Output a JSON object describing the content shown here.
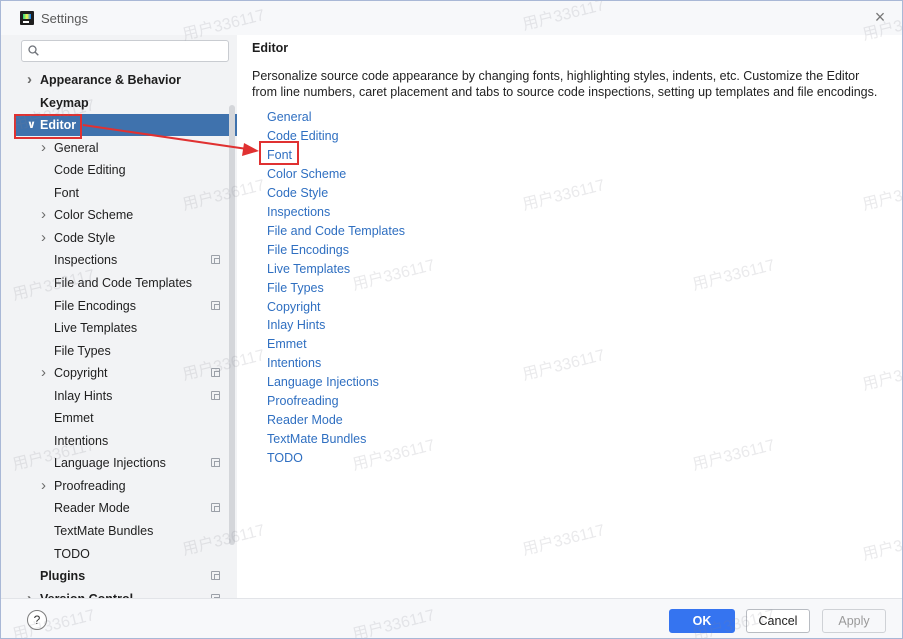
{
  "window": {
    "title": "Settings",
    "close_icon": "×"
  },
  "search": {
    "placeholder": ""
  },
  "sidebar": {
    "items": [
      {
        "label": "Appearance & Behavior",
        "bold": true,
        "chevron": "right",
        "indent": 0,
        "config_icon": false
      },
      {
        "label": "Keymap",
        "bold": true,
        "chevron": "none",
        "indent": 0,
        "config_icon": false
      },
      {
        "label": "Editor",
        "bold": true,
        "chevron": "down",
        "indent": 0,
        "config_icon": false,
        "selected": true
      },
      {
        "label": "General",
        "chevron": "right",
        "indent": 1,
        "config_icon": false
      },
      {
        "label": "Code Editing",
        "chevron": "none",
        "indent": 1,
        "config_icon": false
      },
      {
        "label": "Font",
        "chevron": "none",
        "indent": 1,
        "config_icon": false
      },
      {
        "label": "Color Scheme",
        "chevron": "right",
        "indent": 1,
        "config_icon": false
      },
      {
        "label": "Code Style",
        "chevron": "right",
        "indent": 1,
        "config_icon": false
      },
      {
        "label": "Inspections",
        "chevron": "none",
        "indent": 1,
        "config_icon": true
      },
      {
        "label": "File and Code Templates",
        "chevron": "none",
        "indent": 1,
        "config_icon": false
      },
      {
        "label": "File Encodings",
        "chevron": "none",
        "indent": 1,
        "config_icon": true
      },
      {
        "label": "Live Templates",
        "chevron": "none",
        "indent": 1,
        "config_icon": false
      },
      {
        "label": "File Types",
        "chevron": "none",
        "indent": 1,
        "config_icon": false
      },
      {
        "label": "Copyright",
        "chevron": "right",
        "indent": 1,
        "config_icon": true
      },
      {
        "label": "Inlay Hints",
        "chevron": "none",
        "indent": 1,
        "config_icon": true
      },
      {
        "label": "Emmet",
        "chevron": "none",
        "indent": 1,
        "config_icon": false
      },
      {
        "label": "Intentions",
        "chevron": "none",
        "indent": 1,
        "config_icon": false
      },
      {
        "label": "Language Injections",
        "chevron": "none",
        "indent": 1,
        "config_icon": true
      },
      {
        "label": "Proofreading",
        "chevron": "right",
        "indent": 1,
        "config_icon": false
      },
      {
        "label": "Reader Mode",
        "chevron": "none",
        "indent": 1,
        "config_icon": true
      },
      {
        "label": "TextMate Bundles",
        "chevron": "none",
        "indent": 1,
        "config_icon": false
      },
      {
        "label": "TODO",
        "chevron": "none",
        "indent": 1,
        "config_icon": false
      },
      {
        "label": "Plugins",
        "bold": true,
        "chevron": "none",
        "indent": 0,
        "config_icon": true
      },
      {
        "label": "Version Control",
        "bold": true,
        "chevron": "right",
        "indent": 0,
        "config_icon": true
      }
    ]
  },
  "main": {
    "title": "Editor",
    "description": "Personalize source code appearance by changing fonts, highlighting styles, indents, etc. Customize the Editor from line numbers, caret placement and tabs to source code inspections, setting up templates and file encodings.",
    "links": [
      "General",
      "Code Editing",
      "Font",
      "Color Scheme",
      "Code Style",
      "Inspections",
      "File and Code Templates",
      "File Encodings",
      "Live Templates",
      "File Types",
      "Copyright",
      "Inlay Hints",
      "Emmet",
      "Intentions",
      "Language Injections",
      "Proofreading",
      "Reader Mode",
      "TextMate Bundles",
      "TODO"
    ]
  },
  "footer": {
    "help": "?",
    "ok": "OK",
    "cancel": "Cancel",
    "apply": "Apply"
  },
  "watermark": "用户336117",
  "colors": {
    "selection": "#3f72ad",
    "link": "#2f6fc1",
    "annotation": "#e03131",
    "ok_button": "#3574f0"
  }
}
